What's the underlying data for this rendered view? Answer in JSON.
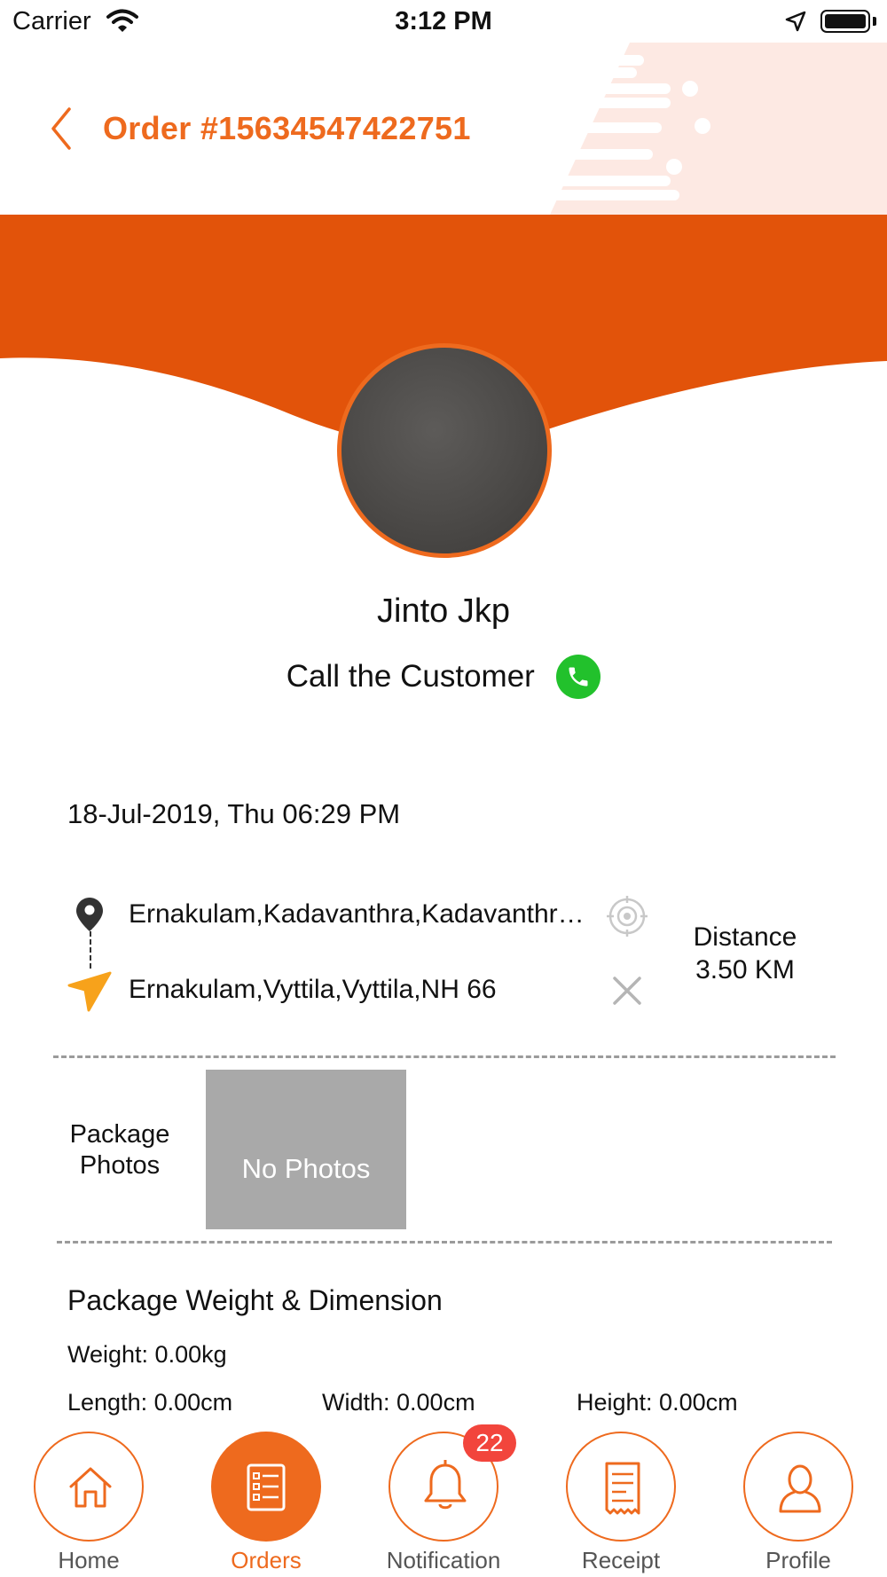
{
  "status_bar": {
    "carrier": "Carrier",
    "time": "3:12 PM"
  },
  "header": {
    "title": "Order #15634547422751",
    "back_icon": "chevron-left-icon"
  },
  "colors": {
    "accent": "#ee6a1e",
    "banner": "#e2530a",
    "call": "#22c12c",
    "badge": "#f2453c"
  },
  "customer": {
    "name": "Jinto Jkp",
    "call_label": "Call the Customer"
  },
  "order": {
    "date": "18-Jul-2019, Thu 06:29 PM",
    "pickup": "Ernakulam,Kadavanthra,Kadavanthra,Kochi",
    "drop": "Ernakulam,Vyttila,Vyttila,NH 66",
    "distance_label": "Distance",
    "distance_value": "3.50 KM"
  },
  "package": {
    "photos_label_1": "Package",
    "photos_label_2": "Photos",
    "no_photos": "No Photos",
    "dimension_title": "Package Weight & Dimension",
    "weight": "Weight: 0.00kg",
    "length": "Length: 0.00cm",
    "width": "Width: 0.00cm",
    "height": "Height: 0.00cm"
  },
  "tabs": [
    {
      "label": "Home",
      "icon": "home-icon",
      "active": false
    },
    {
      "label": "Orders",
      "icon": "orders-icon",
      "active": true
    },
    {
      "label": "Notification",
      "icon": "bell-icon",
      "active": false,
      "badge": "22"
    },
    {
      "label": "Receipt",
      "icon": "receipt-icon",
      "active": false
    },
    {
      "label": "Profile",
      "icon": "profile-icon",
      "active": false
    }
  ]
}
